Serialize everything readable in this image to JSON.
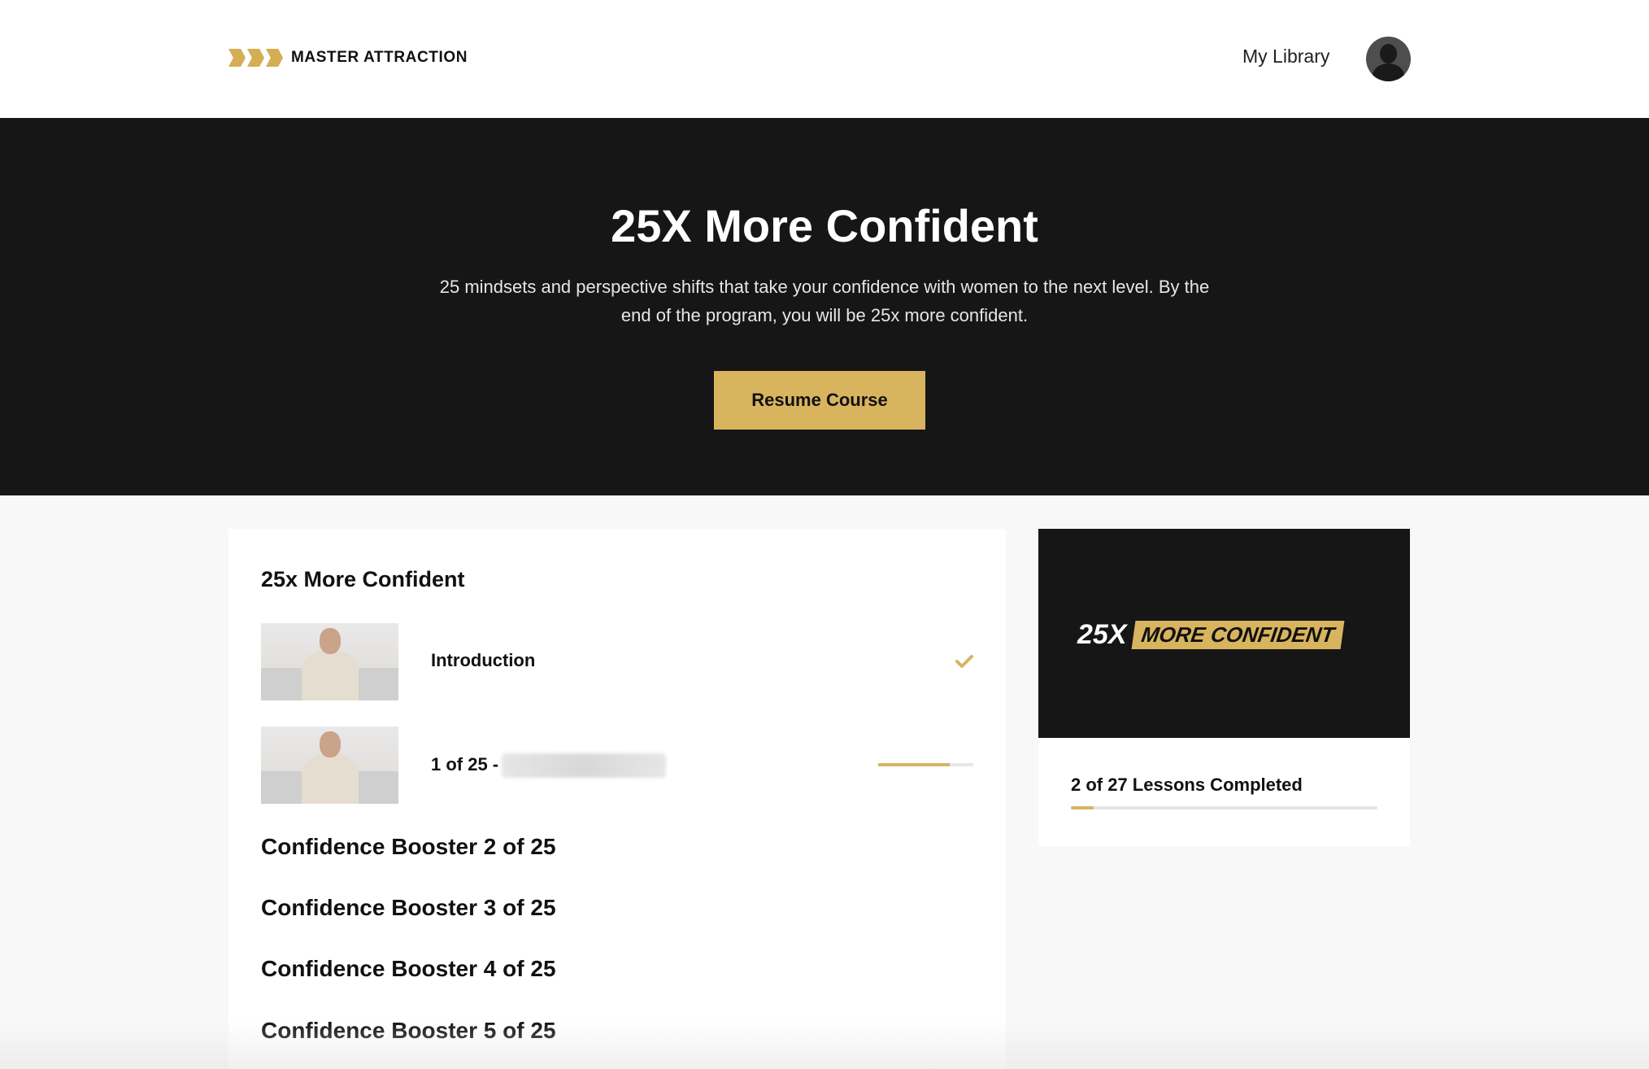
{
  "header": {
    "logo_text": "MASTER ATTRACTION",
    "nav_library": "My Library",
    "logo_icon": "triple-chevron-icon",
    "avatar_icon": "user-avatar-icon"
  },
  "hero": {
    "title": "25X More Confident",
    "description": "25 mindsets and perspective shifts that take your confidence with women to the next level. By the end of the program, you will be 25x more confident.",
    "resume_label": "Resume Course"
  },
  "course": {
    "section_title": "25x More Confident",
    "lessons": [
      {
        "name": "Introduction",
        "completed": true,
        "status_icon": "check-icon"
      },
      {
        "name": "1 of 25 -",
        "completed": false,
        "progress": 0.75
      }
    ],
    "sections": [
      "Confidence Booster 2 of 25",
      "Confidence Booster 3 of 25",
      "Confidence Booster 4 of 25",
      "Confidence Booster 5 of 25"
    ]
  },
  "sidebar": {
    "banner_25x": "25X",
    "banner_tag": "MORE CONFIDENT",
    "progress_label": "2 of 27 Lessons Completed",
    "progress_fraction": 0.074
  },
  "colors": {
    "accent": "#d9b45f",
    "dark": "#161616",
    "page_bg": "#f8f8f8"
  }
}
